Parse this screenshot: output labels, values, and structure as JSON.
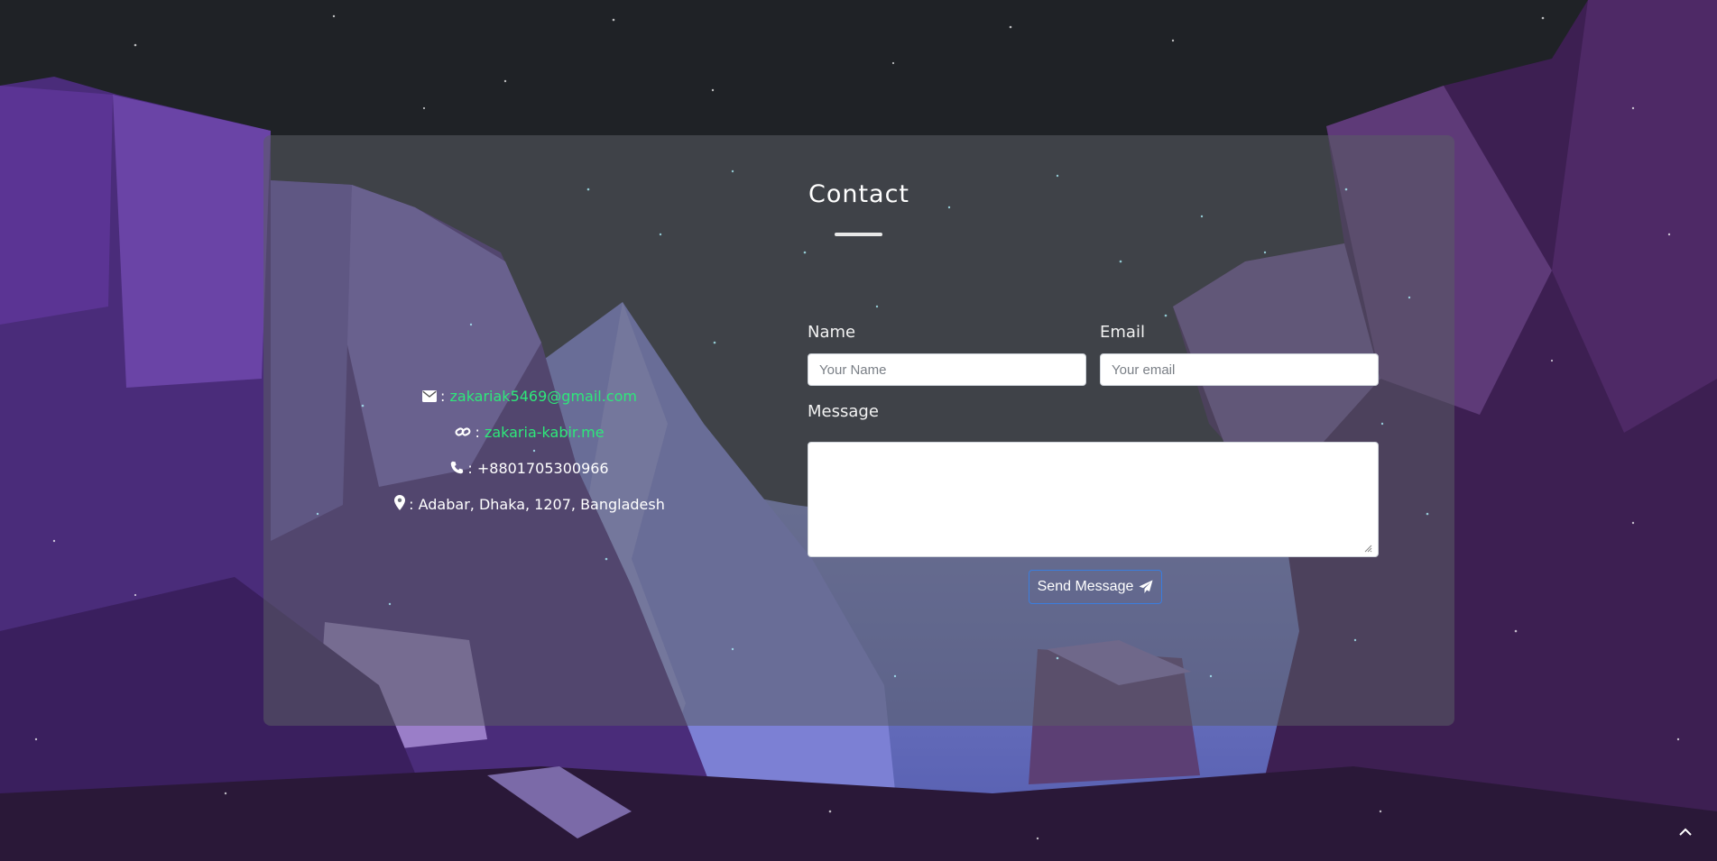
{
  "contact": {
    "title": "Contact",
    "info": {
      "email": "zakariak5469@gmail.com",
      "website": "zakaria-kabir.me",
      "phone": "+8801705300966",
      "address": "Adabar, Dhaka, 1207, Bangladesh",
      "separator": ":"
    },
    "form": {
      "name_label": "Name",
      "name_placeholder": "Your Name",
      "email_label": "Email",
      "email_placeholder": "Your email",
      "message_label": "Message",
      "send_label": "Send Message"
    }
  },
  "colors": {
    "link": "#2ee87a",
    "button_border": "#3b7ddd",
    "card": "rgba(90,92,100,0.55)",
    "sky": "#1f2226"
  },
  "icons": [
    "envelope-icon",
    "link-icon",
    "phone-icon",
    "map-marker-icon",
    "paper-plane-icon",
    "chevron-up-icon"
  ]
}
